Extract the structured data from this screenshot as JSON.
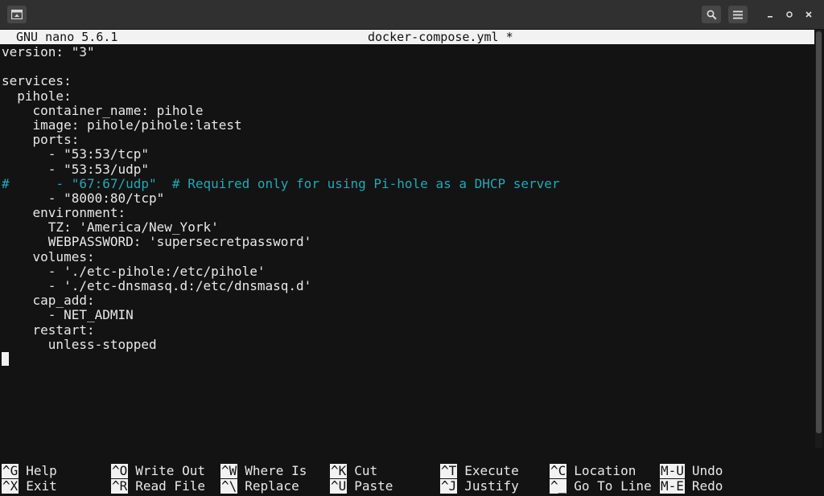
{
  "window": {
    "icons": {
      "app": "terminal-app-icon",
      "search": "search-icon",
      "menu": "hamburger-menu-icon",
      "minimize": "minimize-icon",
      "maximize": "restore-icon",
      "close": "close-icon"
    }
  },
  "nano": {
    "version": "GNU nano 5.6.1",
    "filename": "docker-compose.yml *"
  },
  "editor": {
    "lines": [
      "version: \"3\"",
      "",
      "services:",
      "  pihole:",
      "    container_name: pihole",
      "    image: pihole/pihole:latest",
      "    ports:",
      "      - \"53:53/tcp\"",
      "      - \"53:53/udp\"",
      "#      - \"67:67/udp\"  # Required only for using Pi-hole as a DHCP server",
      "      - \"8000:80/tcp\"",
      "    environment:",
      "      TZ: 'America/New_York'",
      "      WEBPASSWORD: 'supersecretpassword'",
      "    volumes:",
      "      - './etc-pihole:/etc/pihole'",
      "      - './etc-dnsmasq.d:/etc/dnsmasq.d'",
      "    cap_add:",
      "      - NET_ADMIN",
      "    restart:",
      "      unless-stopped"
    ]
  },
  "shortcuts": [
    {
      "key": "^G",
      "label": "Help"
    },
    {
      "key": "^X",
      "label": "Exit"
    },
    {
      "key": "^O",
      "label": "Write Out"
    },
    {
      "key": "^R",
      "label": "Read File"
    },
    {
      "key": "^W",
      "label": "Where Is"
    },
    {
      "key": "^\\",
      "label": "Replace"
    },
    {
      "key": "^K",
      "label": "Cut"
    },
    {
      "key": "^U",
      "label": "Paste"
    },
    {
      "key": "^T",
      "label": "Execute"
    },
    {
      "key": "^J",
      "label": "Justify"
    },
    {
      "key": "^C",
      "label": "Location"
    },
    {
      "key": "^_",
      "label": "Go To Line"
    },
    {
      "key": "M-U",
      "label": "Undo"
    },
    {
      "key": "M-E",
      "label": "Redo"
    }
  ],
  "colors": {
    "background": "#131313",
    "text": "#e8e8e8",
    "comment": "#26a6b6",
    "header_bg": "#f2f2f2"
  }
}
